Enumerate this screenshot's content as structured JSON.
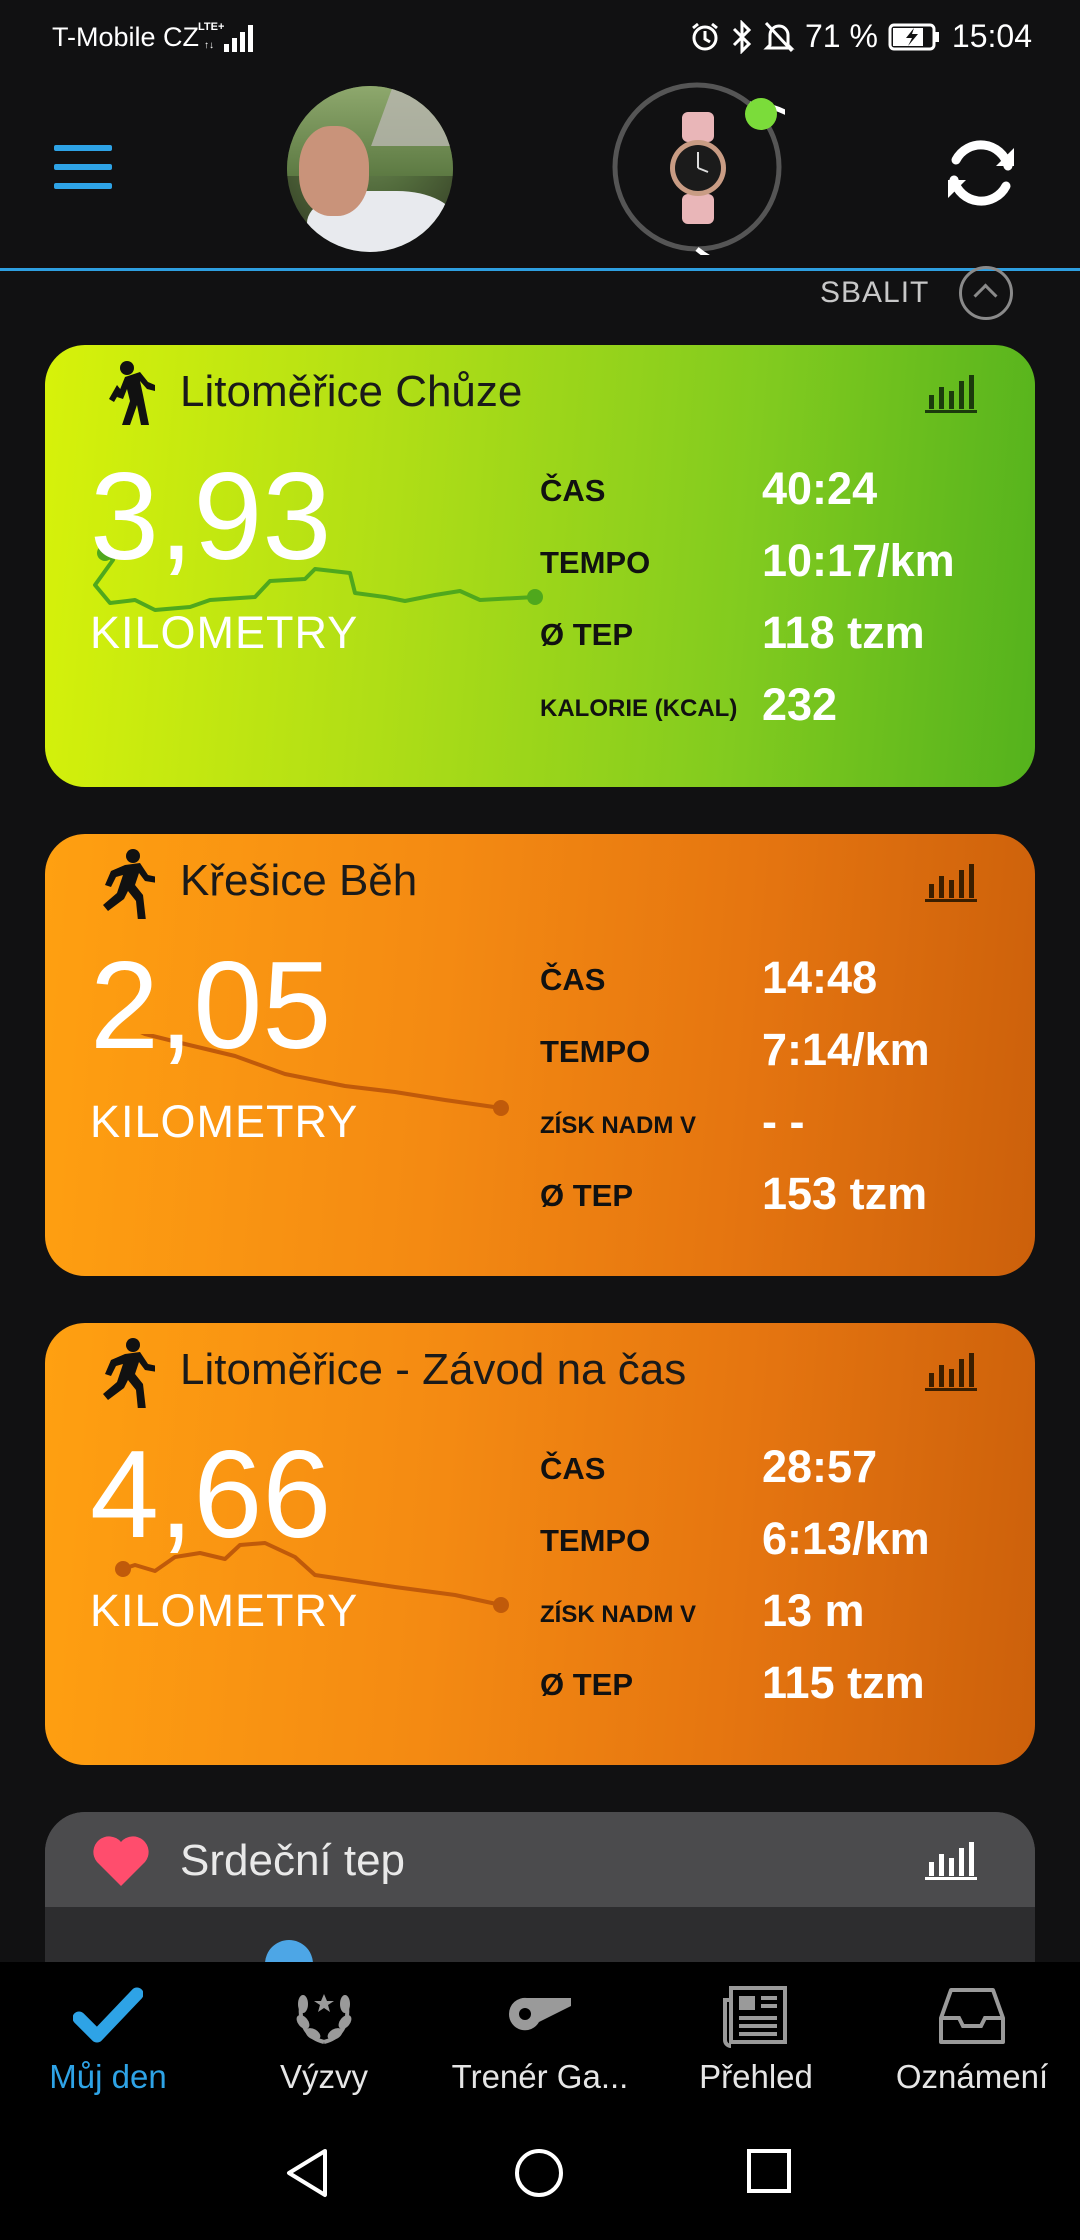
{
  "status_bar": {
    "carrier": "T-Mobile CZ",
    "network": "LTE+",
    "battery": "71 %",
    "time": "15:04"
  },
  "header": {
    "menu_icon": "hamburger-menu-icon",
    "avatar": "profile-photo",
    "device_icon": "watch-icon",
    "sync_icon": "sync-icon"
  },
  "collapse": {
    "label": "SBALIT"
  },
  "activities": [
    {
      "title": "Litoměřice Chůze",
      "icon": "walk-icon",
      "value": "3,93",
      "unit": "KILOMETRY",
      "stats": [
        {
          "label": "ČAS",
          "value": "40:24"
        },
        {
          "label": "TEMPO",
          "value": "10:17/km"
        },
        {
          "label": "Ø TEP",
          "value": "118 tzm"
        },
        {
          "label": "KALORIE (KCAL)",
          "value": "232"
        }
      ]
    },
    {
      "title": "Křešice Běh",
      "icon": "run-icon",
      "value": "2,05",
      "unit": "KILOMETRY",
      "stats": [
        {
          "label": "ČAS",
          "value": "14:48"
        },
        {
          "label": "TEMPO",
          "value": "7:14/km"
        },
        {
          "label": "ZÍSK NADM V",
          "value": "- -"
        },
        {
          "label": "Ø TEP",
          "value": "153 tzm"
        }
      ]
    },
    {
      "title": "Litoměřice - Závod na čas",
      "icon": "run-icon",
      "value": "4,66",
      "unit": "KILOMETRY",
      "stats": [
        {
          "label": "ČAS",
          "value": "28:57"
        },
        {
          "label": "TEMPO",
          "value": "6:13/km"
        },
        {
          "label": "ZÍSK NADM V",
          "value": "13 m"
        },
        {
          "label": "Ø TEP",
          "value": "115 tzm"
        }
      ]
    }
  ],
  "heart_card": {
    "title": "Srdeční tep",
    "icon": "heart-icon"
  },
  "bottom_nav": [
    {
      "label": "Můj den",
      "icon": "checkmark-icon",
      "active": true
    },
    {
      "label": "Výzvy",
      "icon": "laurel-icon",
      "active": false
    },
    {
      "label": "Trenér Ga...",
      "icon": "whistle-icon",
      "active": false
    },
    {
      "label": "Přehled",
      "icon": "newspaper-icon",
      "active": false
    },
    {
      "label": "Oznámení",
      "icon": "inbox-icon",
      "active": false
    }
  ],
  "colors": {
    "accent": "#2ea3e6",
    "walk_card": "#8fd11a",
    "run_card": "#f08a12",
    "heart": "#ff4d6d"
  }
}
